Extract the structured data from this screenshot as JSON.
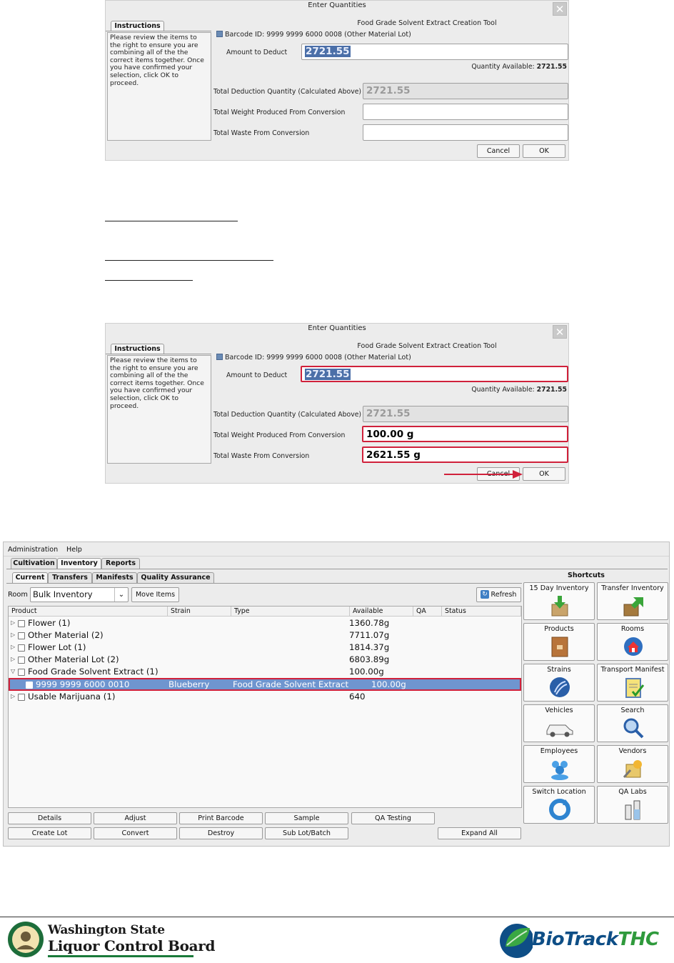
{
  "dialog": {
    "title": "Enter Quantities",
    "tool": "Food Grade Solvent Extract Creation Tool",
    "instructions_tab": "Instructions",
    "instructions_text": "Please review the items to the right to ensure you are combining all of the the correct items together. Once you have confirmed your selection, click OK to proceed.",
    "barcode": "Barcode ID: 9999 9999 6000 0008 (Other Material Lot)",
    "amount_label": "Amount to Deduct",
    "amount_value": "2721.55",
    "qty_avail_label": "Quantity Available:",
    "qty_avail_value": "2721.55",
    "total_deduct_label": "Total Deduction Quantity (Calculated Above)",
    "total_deduct_value": "2721.55",
    "weight_label": "Total Weight Produced From Conversion",
    "waste_label": "Total Waste From Conversion",
    "cancel": "Cancel",
    "ok": "OK"
  },
  "dialog2": {
    "weight_value": "100.00 g",
    "waste_value": "2621.55 g"
  },
  "app": {
    "menu": [
      "Administration",
      "Help"
    ],
    "top_tabs": [
      "Cultivation",
      "Inventory",
      "Reports"
    ],
    "sub_tabs": [
      "Current",
      "Transfers",
      "Manifests",
      "Quality Assurance"
    ],
    "room_label": "Room",
    "room_value": "Bulk Inventory",
    "move_items": "Move Items",
    "refresh": "Refresh",
    "columns": [
      "Product",
      "Strain",
      "Type",
      "Available",
      "QA",
      "Status"
    ],
    "rows": [
      {
        "name": "Flower (1)",
        "available": "1360.78g"
      },
      {
        "name": "Other Material (2)",
        "available": "7711.07g"
      },
      {
        "name": "Flower Lot (1)",
        "available": "1814.37g"
      },
      {
        "name": "Other Material Lot (2)",
        "available": "6803.89g"
      },
      {
        "name": "Food Grade Solvent Extract (1)",
        "available": "100.00g"
      },
      {
        "name": "9999 9999 6000 0010",
        "strain": "Blueberry",
        "type": "Food Grade Solvent Extract",
        "available": "100.00g"
      },
      {
        "name": "Usable Marijuana (1)",
        "available": "640"
      }
    ],
    "buttons_row1": [
      "Details",
      "Adjust",
      "Print Barcode",
      "Sample",
      "QA Testing"
    ],
    "buttons_row2": [
      "Create Lot",
      "Convert",
      "Destroy",
      "Sub Lot/Batch",
      "Expand All"
    ],
    "shortcuts_title": "Shortcuts",
    "shortcuts": [
      {
        "label": "15 Day Inventory",
        "icon": "box-down-icon"
      },
      {
        "label": "Transfer Inventory",
        "icon": "box-transfer-icon"
      },
      {
        "label": "Products",
        "icon": "products-icon"
      },
      {
        "label": "Rooms",
        "icon": "rooms-icon"
      },
      {
        "label": "Strains",
        "icon": "strains-globe-icon"
      },
      {
        "label": "Transport Manifest",
        "icon": "manifest-clipboard-icon"
      },
      {
        "label": "Vehicles",
        "icon": "vehicle-icon"
      },
      {
        "label": "Search",
        "icon": "search-icon"
      },
      {
        "label": "Employees",
        "icon": "employees-icon"
      },
      {
        "label": "Vendors",
        "icon": "vendors-icon"
      },
      {
        "label": "Switch Location",
        "icon": "switch-location-icon"
      },
      {
        "label": "QA Labs",
        "icon": "qa-labs-icon"
      }
    ]
  },
  "footer": {
    "wa_line1": "Washington State",
    "wa_line2": "Liquor Control Board",
    "biotrack_main": "BioTrack",
    "biotrack_suffix": "THC"
  },
  "colors": {
    "highlight": "#d0213b",
    "selection": "#6f95cf",
    "brand_blue": "#0e4e86",
    "brand_green": "#2f9a3c"
  }
}
